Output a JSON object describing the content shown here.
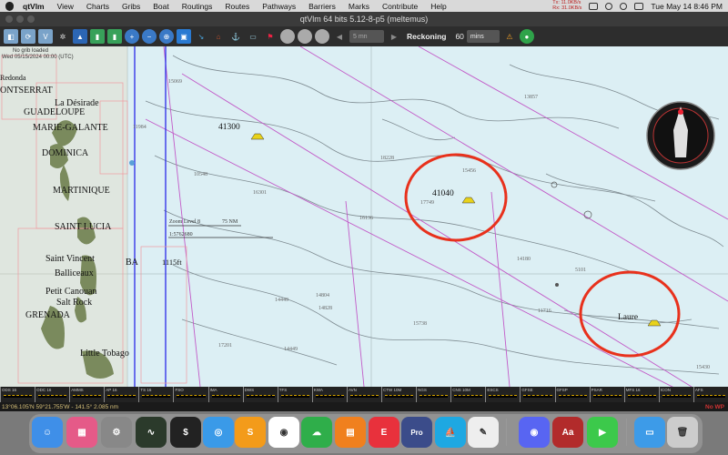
{
  "menubar": {
    "app_name": "qtVlm",
    "items": [
      "View",
      "Charts",
      "Gribs",
      "Boat",
      "Routings",
      "Routes",
      "Pathways",
      "Barriers",
      "Marks",
      "Contribute",
      "Help"
    ],
    "net_tx": "Tx:  11.0KB/s",
    "net_rx": "Rx:  31.0KB/s",
    "clock": "Tue May 14  8:46 PM"
  },
  "window": {
    "title": "qtVlm 64 bits 5.12-8-p5 (meltemus)"
  },
  "toolbar": {
    "step_dropdown": "5 mn",
    "mode_label": "Reckoning",
    "duration_value": "60",
    "unit_dropdown": "mins"
  },
  "chart": {
    "grib_status": "No grib loaded",
    "grib_date": "Wed 05/15/2024 00:00 (UTC)",
    "zoom_level": "Zoom Level 8",
    "scale_length": "75 NM",
    "scale_ratio": "1:5762680",
    "islands": [
      "Redonda",
      "ONTSERRAT",
      "La Désirade",
      "GUADELOUPE",
      "MARIE-GALANTE",
      "DOMINICA",
      "MARTINIQUE",
      "SAINT LUCIA",
      "Saint Vincent",
      "Balliceaux",
      "Petit Canouan",
      "Salt Rock",
      "GRENADA",
      "Little Tobago",
      "BA"
    ],
    "boats": [
      {
        "name": "41300",
        "color": "#e8d21a"
      },
      {
        "name": "41040",
        "color": "#e8d21a"
      },
      {
        "name": "Laure",
        "color": "#e8d21a"
      }
    ],
    "spot_height": "1115ft",
    "depth_soundings": [
      "15069",
      "13857",
      "11984",
      "10548",
      "18228",
      "15456",
      "16136",
      "17749",
      "14804",
      "14449",
      "14828",
      "15738",
      "14449",
      "17201",
      "16301",
      "15430",
      "11716",
      "14180",
      "5101"
    ],
    "highlight_color": "#e8311c"
  },
  "timeline": {
    "segments": [
      "ODS 16",
      "ODC 16",
      "AMMS",
      "AP 16",
      "TS 16",
      "FSO",
      "IMA",
      "DWS",
      "TFS",
      "KWA",
      "AVN",
      "CTW 10M",
      "NGS",
      "CNS 10M",
      "ESCS",
      "GFSE",
      "GFSP",
      "PSAR",
      "MFS 16",
      "ICON",
      "AFS"
    ]
  },
  "status": {
    "position": "13°06.105'N 59°21.755'W - 141.5° 2.085 nm",
    "right": "No WP"
  },
  "dock": {
    "apps": [
      "finder-icon",
      "launchpad-icon",
      "settings-icon",
      "activity-monitor-icon",
      "terminal-icon",
      "safari-icon",
      "sublime-icon",
      "chrome-icon",
      "server-icon",
      "books-icon",
      "expressvpn-icon",
      "macvim-pro-icon",
      "qtvlm-icon",
      "textedit-icon",
      "discord-icon",
      "dictionary-icon",
      "facetime-icon",
      "downloads-icon",
      "trash-icon"
    ],
    "badge_pro": "Pro",
    "dict_text": "Aa"
  }
}
